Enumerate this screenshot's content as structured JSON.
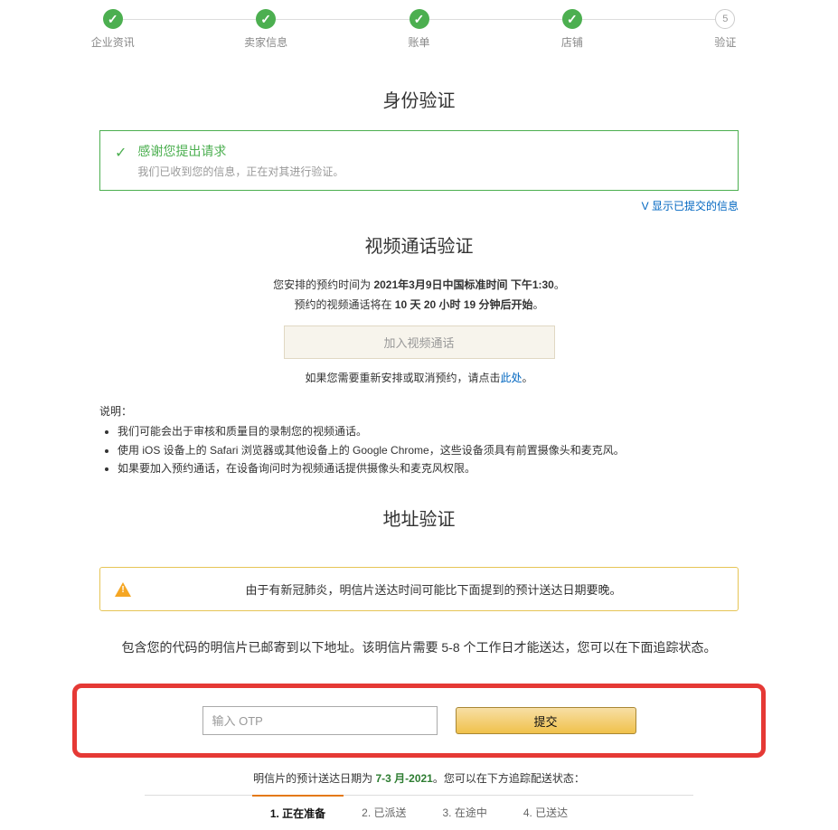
{
  "stepper": {
    "steps": [
      {
        "label": "企业资讯",
        "done": true
      },
      {
        "label": "卖家信息",
        "done": true
      },
      {
        "label": "账单",
        "done": true
      },
      {
        "label": "店铺",
        "done": true
      },
      {
        "label": "验证",
        "done": false,
        "num": "5"
      }
    ]
  },
  "titles": {
    "identity": "身份验证",
    "video": "视频通话验证",
    "address": "地址验证"
  },
  "success": {
    "title": "感谢您提出请求",
    "sub": "我们已收到您的信息，正在对其进行验证。"
  },
  "showLink": "V 显示已提交的信息",
  "video": {
    "line1_a": "您安排的预约时间为 ",
    "line1_b": "2021年3月9日中国标准时间 下午1:30",
    "line1_c": "。",
    "line2_a": "预约的视频通话将在 ",
    "line2_b": "10 天 20 小时 19 分钟后开始",
    "line2_c": "。",
    "cta": "加入视频通话",
    "resched_a": "如果您需要重新安排或取消预约，请点击",
    "resched_b": "此处",
    "resched_c": "。"
  },
  "bulletsTitle": "说明：",
  "bullets": [
    "我们可能会出于审核和质量目的录制您的视频通话。",
    "使用 iOS 设备上的 Safari 浏览器或其他设备上的 Google Chrome，这些设备须具有前置摄像头和麦克风。",
    "如果要加入预约通话，在设备询问时为视频通话提供摄像头和麦克风权限。"
  ],
  "warning": "由于有新冠肺炎，明信片送达时间可能比下面提到的预计送达日期要晚。",
  "addr_desc": "包含您的代码的明信片已邮寄到以下地址。该明信片需要 5-8 个工作日才能送达，您可以在下面追踪状态。",
  "otp": {
    "placeholder": "输入 OTP",
    "submit": "提交"
  },
  "eta": {
    "a": "明信片的预计送达日期为 ",
    "b": "7-3 月-2021",
    "c": "。您可以在下方追踪配送状态："
  },
  "track": {
    "tabs": [
      "1. 正在准备",
      "2. 已派送",
      "3. 在途中",
      "4. 已送达"
    ],
    "active": 0
  }
}
